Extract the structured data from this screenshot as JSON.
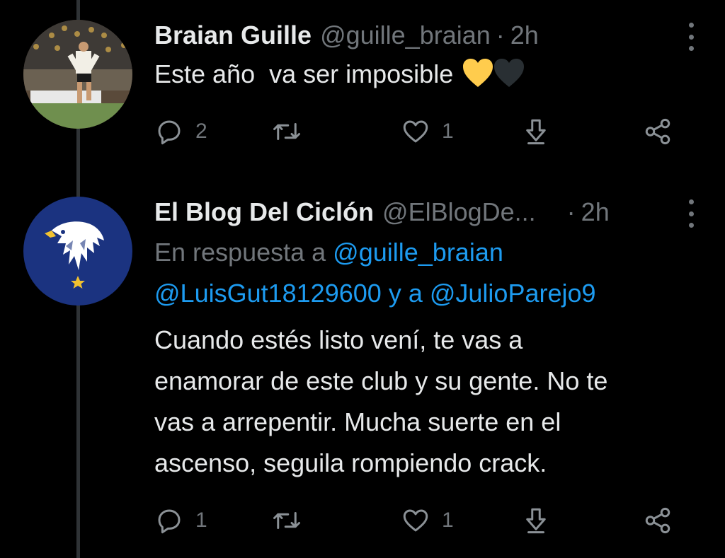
{
  "tweets": [
    {
      "name": "Braian Guille",
      "handle": "@guille_braian",
      "dot": "·",
      "time": "2h",
      "text_before": "Este año  va ser imposible",
      "hearts": [
        "yellow-heart",
        "black-heart"
      ],
      "actions": {
        "reply_count": "2",
        "retweet_count": "",
        "like_count": "1"
      }
    },
    {
      "name": "El Blog Del Ciclón",
      "handle": "@ElBlogDe...",
      "dot": "·",
      "time": "2h",
      "reply_prefix": "En respuesta a",
      "reply_mention_1": "@guille_braian",
      "reply_mention_2": "@LuisGut18129600",
      "reply_and": "y a",
      "reply_mention_3": "@JulioParejo9",
      "text_lines": [
        "Cuando estés listo vení, te vas a",
        "enamorar de este club y su gente. No te",
        "vas a arrepentir. Mucha suerte en el",
        "ascenso, seguila rompiendo crack."
      ],
      "actions": {
        "reply_count": "1",
        "retweet_count": "",
        "like_count": "1"
      }
    }
  ],
  "colors": {
    "background": "#000000",
    "text": "#e7e9ea",
    "secondary": "#71767b",
    "accent": "#1d9bf0",
    "yellow_heart": "#ffcc4d",
    "thread_line": "#2f3336"
  }
}
